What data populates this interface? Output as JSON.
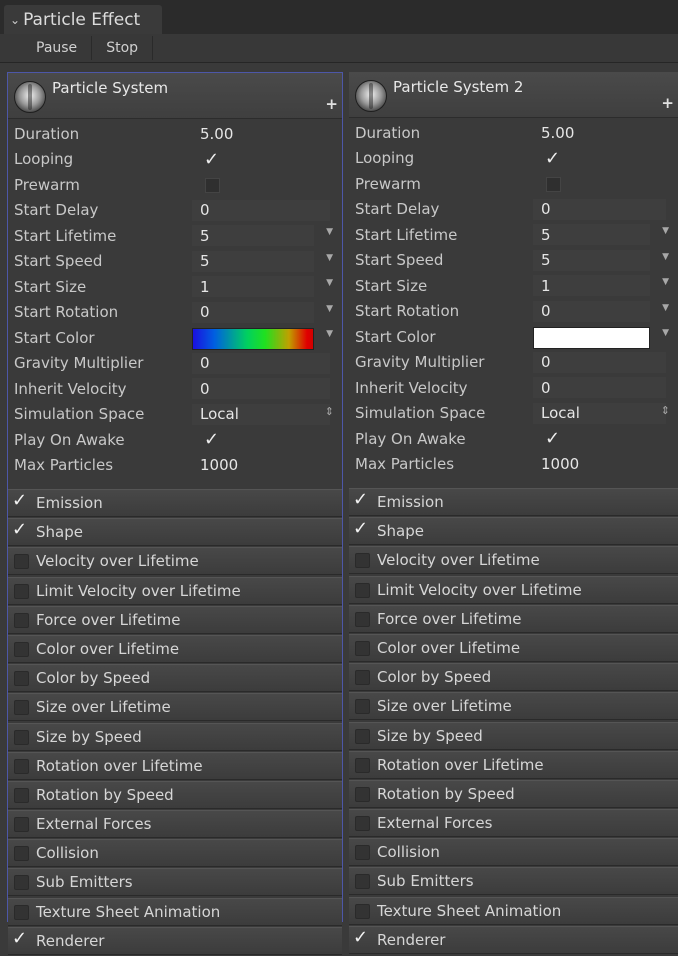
{
  "tab": {
    "chevron": "⌄",
    "title": "Particle Effect"
  },
  "toolbar": {
    "pause": "Pause",
    "stop": "Stop"
  },
  "panels": [
    {
      "title": "Particle System",
      "add": "+",
      "values": {
        "duration": "5.00",
        "start_delay": "0",
        "start_lifetime": "5",
        "start_speed": "5",
        "start_size": "1",
        "start_rotation": "0",
        "gravity_multiplier": "0",
        "inherit_velocity": "0",
        "simulation_space": "Local",
        "max_particles": "1000"
      },
      "start_color": "gradient",
      "looping": true,
      "prewarm": false,
      "play_on_awake": true,
      "modules_enabled": [
        true,
        true,
        false,
        false,
        false,
        false,
        false,
        false,
        false,
        false,
        false,
        false,
        false,
        false,
        false,
        true
      ]
    },
    {
      "title": "Particle System 2",
      "add": "+",
      "values": {
        "duration": "5.00",
        "start_delay": "0",
        "start_lifetime": "5",
        "start_speed": "5",
        "start_size": "1",
        "start_rotation": "0",
        "gravity_multiplier": "0",
        "inherit_velocity": "0",
        "simulation_space": "Local",
        "max_particles": "1000"
      },
      "start_color": "#ffffff",
      "looping": true,
      "prewarm": false,
      "play_on_awake": true,
      "modules_enabled": [
        true,
        true,
        false,
        false,
        false,
        false,
        false,
        false,
        false,
        false,
        false,
        false,
        false,
        false,
        false,
        true
      ]
    }
  ],
  "labels": {
    "duration": "Duration",
    "looping": "Looping",
    "prewarm": "Prewarm",
    "start_delay": "Start Delay",
    "start_lifetime": "Start Lifetime",
    "start_speed": "Start Speed",
    "start_size": "Start Size",
    "start_rotation": "Start Rotation",
    "start_color": "Start Color",
    "gravity_multiplier": "Gravity Multiplier",
    "inherit_velocity": "Inherit Velocity",
    "simulation_space": "Simulation Space",
    "play_on_awake": "Play On Awake",
    "max_particles": "Max Particles"
  },
  "modules": [
    "Emission",
    "Shape",
    "Velocity over Lifetime",
    "Limit Velocity over Lifetime",
    "Force over Lifetime",
    "Color over Lifetime",
    "Color by Speed",
    "Size over Lifetime",
    "Size by Speed",
    "Rotation over Lifetime",
    "Rotation by Speed",
    "External Forces",
    "Collision",
    "Sub Emitters",
    "Texture Sheet Animation",
    "Renderer"
  ],
  "icons": {
    "check": "✓",
    "dropdown": "▼",
    "updown": "⇕"
  },
  "colors": {
    "selection_border": "#4d57a8",
    "background": "#3a3a3a"
  }
}
